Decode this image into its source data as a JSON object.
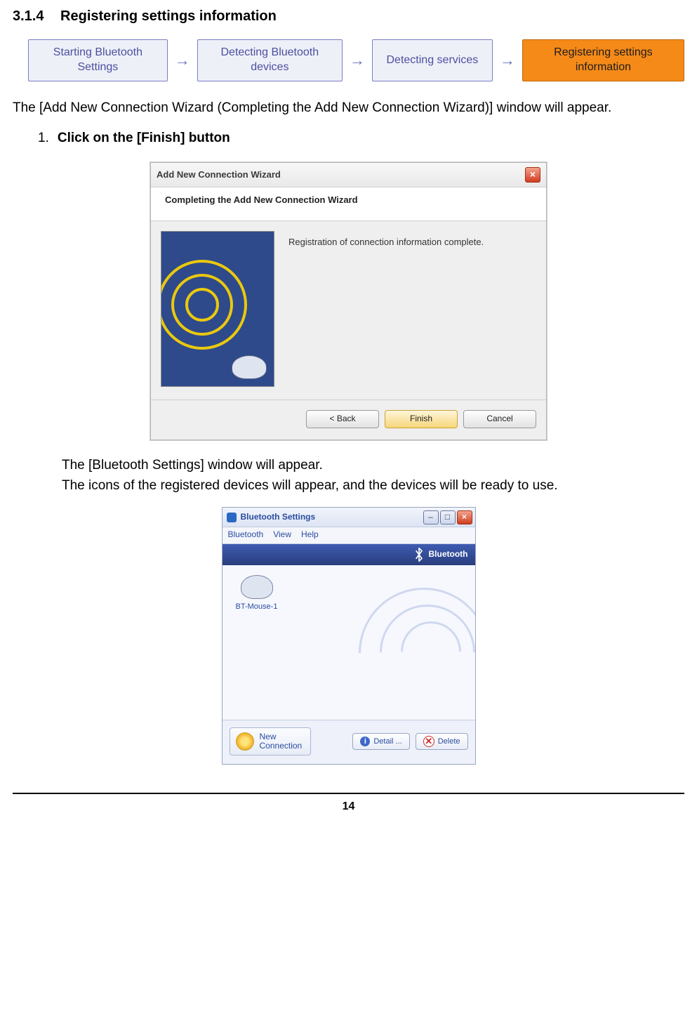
{
  "heading": {
    "number": "3.1.4",
    "title": "Registering settings information"
  },
  "flow": {
    "steps": [
      "Starting Bluetooth Settings",
      "Detecting Bluetooth devices",
      "Detecting services",
      "Registering settings information"
    ],
    "active_index": 3
  },
  "para1": "The [Add New Connection Wizard (Completing the Add New Connection Wizard)] window will appear.",
  "step": {
    "number": "1.",
    "text": "Click on the [Finish] button"
  },
  "wizard": {
    "title": "Add New Connection Wizard",
    "subtitle": "Completing the Add New Connection Wizard",
    "message": "Registration of connection information complete.",
    "back": "< Back",
    "finish": "Finish",
    "cancel": "Cancel",
    "close_glyph": "×"
  },
  "after": {
    "line1": "The [Bluetooth Settings] window will appear.",
    "line2": "The icons of the registered devices will appear, and the devices will be ready to use."
  },
  "bt": {
    "title": "Bluetooth Settings",
    "menu": {
      "m1": "Bluetooth",
      "m2": "View",
      "m3": "Help"
    },
    "brand": "Bluetooth",
    "device_label": "BT-Mouse-1",
    "new_connection_label1": "New",
    "new_connection_label2": "Connection",
    "detail": "Detail ...",
    "delete": "Delete",
    "win": {
      "min": "–",
      "max": "□",
      "close": "×"
    }
  },
  "page_number": "14"
}
